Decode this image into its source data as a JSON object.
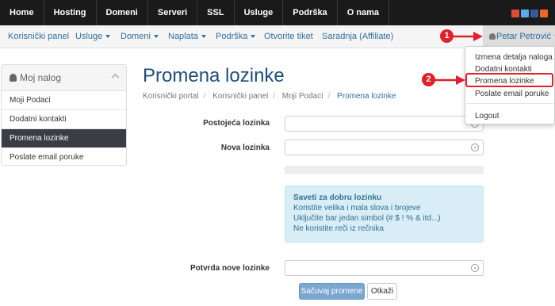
{
  "top_nav": [
    "Home",
    "Hosting",
    "Domeni",
    "Serveri",
    "SSL",
    "Usluge",
    "Podrška",
    "O nama"
  ],
  "social_icons": [
    {
      "name": "googleplus-icon",
      "color": "#dd4b39"
    },
    {
      "name": "twitter-icon",
      "color": "#55acee"
    },
    {
      "name": "facebook-icon",
      "color": "#3b5998"
    },
    {
      "name": "rss-icon",
      "color": "#f26522"
    }
  ],
  "sub_nav": {
    "portal": "Korisnički panel",
    "services": "Usluge",
    "domains": "Domeni",
    "billing": "Naplata",
    "support": "Podrška",
    "open_ticket": "Otvorite tiket",
    "affiliate": "Saradnja (Affiliate)",
    "user": "Petar Petrović"
  },
  "sidebar": {
    "title": "Moj nalog",
    "items": [
      "Moji Podaci",
      "Dodatni kontakti",
      "Promena lozinke",
      "Poslate email poruke"
    ],
    "active_index": 2
  },
  "page": {
    "title": "Promena lozinke",
    "breadcrumb": [
      "Korisnički portal",
      "Korisnički panel",
      "Moji Podaci",
      "Promena lozinke"
    ]
  },
  "form": {
    "current_label": "Postojeća lozinka",
    "new_label": "Nova lozinka",
    "confirm_label": "Potvrda nove lozinke",
    "tips_title": "Saveti za dobru lozinku",
    "tips": [
      "Koristite velika i mala slova i brojeve",
      "Uključite bar jedan simbol (# $ ! % & itd...)",
      "Ne koristite reči iz rečnika"
    ],
    "save_button": "Sačuvaj promene",
    "cancel_button": "Otkaži"
  },
  "dropdown": {
    "items": [
      "Izmena detalja naloga",
      "Dodatni kontakti",
      "Promena lozinke",
      "Poslate email poruke",
      "Logout"
    ],
    "highlighted_index": 2
  },
  "annotations": {
    "badge1": "1",
    "badge2": "2",
    "color": "#e0202a"
  }
}
